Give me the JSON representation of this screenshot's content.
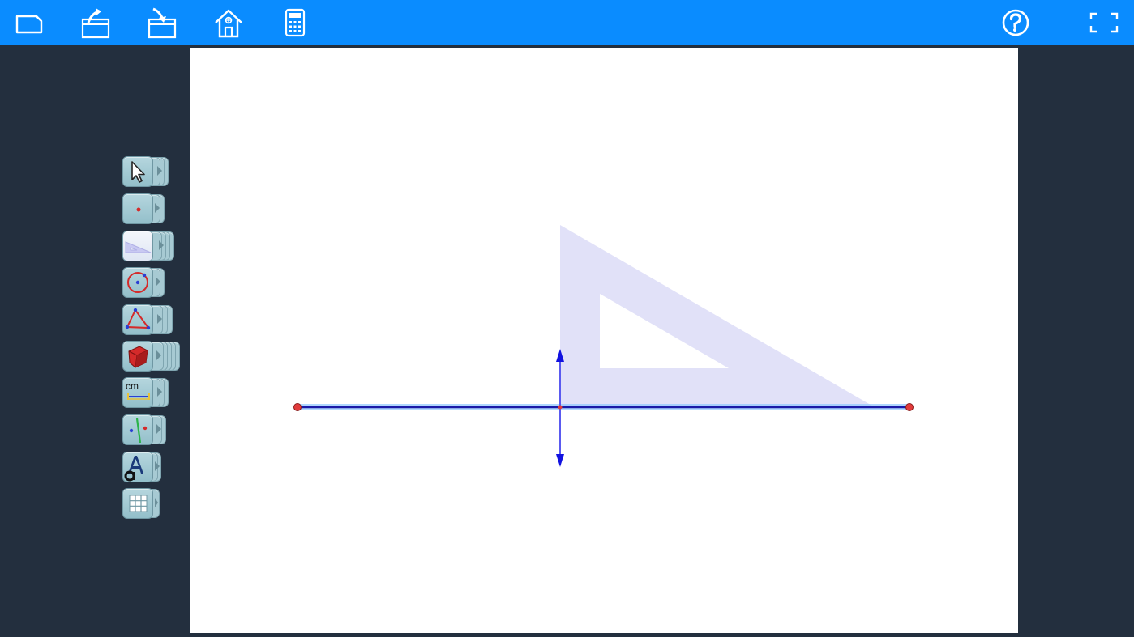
{
  "toolbar": {
    "buttons": [
      {
        "name": "new-document-icon"
      },
      {
        "name": "export-icon"
      },
      {
        "name": "import-icon"
      },
      {
        "name": "home-icon"
      },
      {
        "name": "calculator-icon"
      }
    ],
    "right_buttons": [
      {
        "name": "help-icon"
      },
      {
        "name": "fullscreen-icon"
      }
    ]
  },
  "tools": [
    {
      "name": "select-tool",
      "icon": "pointer-icon",
      "stack": 4
    },
    {
      "name": "point-tool",
      "icon": "point-icon",
      "stack": 3
    },
    {
      "name": "set-square-tool",
      "icon": "set-square-icon",
      "stack": 5
    },
    {
      "name": "circle-tool",
      "icon": "circle-icon",
      "stack": 3
    },
    {
      "name": "polygon-tool",
      "icon": "triangle-icon",
      "stack": 4
    },
    {
      "name": "solid-tool",
      "icon": "cube-icon",
      "stack": 6
    },
    {
      "name": "measure-tool",
      "icon": "ruler-cm-icon",
      "stack": 4,
      "label": "cm"
    },
    {
      "name": "construction-tool",
      "icon": "line-points-icon",
      "stack": 4
    },
    {
      "name": "text-tool",
      "icon": "text-icon",
      "stack": 3
    },
    {
      "name": "grid-tool",
      "icon": "grid-icon",
      "stack": 2
    }
  ],
  "colors": {
    "topbar": "#0a8cff",
    "background": "#232f3e",
    "segment": "#1a1aa8",
    "segment_glow": "#8ec8ff",
    "point": "#e23b3b",
    "set_square": "#dcdcf7",
    "arrow": "#1212e0"
  }
}
